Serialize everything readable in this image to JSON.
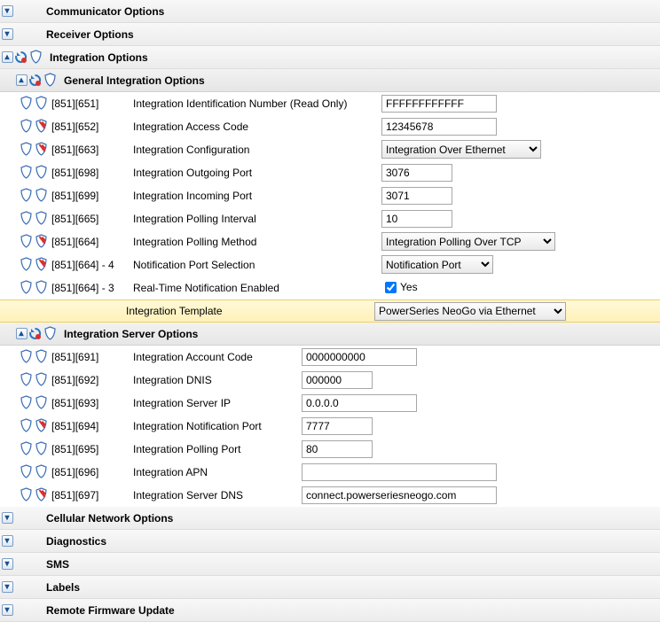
{
  "sections": {
    "communicator": "Communicator Options",
    "receiver": "Receiver Options",
    "integration": "Integration Options",
    "general_integration": "General Integration Options",
    "integration_server": "Integration Server Options",
    "cellular": "Cellular Network Options",
    "diagnostics": "Diagnostics",
    "sms": "SMS",
    "labels": "Labels",
    "remote_fw": "Remote Firmware Update"
  },
  "gen": {
    "items": [
      {
        "code": "[851][651]",
        "label": "Integration Identification Number (Read Only)",
        "type": "text",
        "value": "FFFFFFFFFFFF",
        "shield2": "plain",
        "width": "w130"
      },
      {
        "code": "[851][652]",
        "label": "Integration Access Code",
        "type": "text",
        "value": "12345678",
        "shield2": "red",
        "width": "w130"
      },
      {
        "code": "[851][663]",
        "label": "Integration Configuration",
        "type": "select",
        "value": "Integration Over Ethernet",
        "shield2": "red",
        "width": "180"
      },
      {
        "code": "[851][698]",
        "label": "Integration Outgoing Port",
        "type": "text",
        "value": "3076",
        "shield2": "plain",
        "width": "w80"
      },
      {
        "code": "[851][699]",
        "label": "Integration Incoming Port",
        "type": "text",
        "value": "3071",
        "shield2": "plain",
        "width": "w80"
      },
      {
        "code": "[851][665]",
        "label": "Integration Polling Interval",
        "type": "text",
        "value": "10",
        "shield2": "plain",
        "width": "w80"
      },
      {
        "code": "[851][664]",
        "label": "Integration Polling Method",
        "type": "select",
        "value": "Integration Polling Over TCP",
        "shield2": "red",
        "width": "196"
      },
      {
        "code": "[851][664] - 4",
        "label": "Notification Port Selection",
        "type": "select",
        "value": "Notification Port",
        "shield2": "red",
        "width": "126"
      },
      {
        "code": "[851][664] - 3",
        "label": "Real-Time Notification Enabled",
        "type": "check",
        "value": "Yes",
        "shield2": "plain"
      }
    ]
  },
  "template": {
    "label": "Integration Template",
    "value": "PowerSeries NeoGo via Ethernet"
  },
  "srv": {
    "items": [
      {
        "code": "[851][691]",
        "label": "Integration Account Code",
        "type": "text",
        "value": "0000000000",
        "shield2": "plain",
        "width": "w130"
      },
      {
        "code": "[851][692]",
        "label": "Integration DNIS",
        "type": "text",
        "value": "000000",
        "shield2": "plain",
        "width": "w80"
      },
      {
        "code": "[851][693]",
        "label": "Integration Server IP",
        "type": "text",
        "value": "0.0.0.0",
        "shield2": "plain",
        "width": "w130"
      },
      {
        "code": "[851][694]",
        "label": "Integration Notification Port",
        "type": "text",
        "value": "7777",
        "shield2": "red",
        "width": "w80"
      },
      {
        "code": "[851][695]",
        "label": "Integration Polling Port",
        "type": "text",
        "value": "80",
        "shield2": "plain",
        "width": "w80"
      },
      {
        "code": "[851][696]",
        "label": "Integration APN",
        "type": "text",
        "value": "",
        "shield2": "plain",
        "width": "w220"
      },
      {
        "code": "[851][697]",
        "label": "Integration Server DNS",
        "type": "text",
        "value": "connect.powerseriesneogo.com",
        "shield2": "red",
        "width": "w220"
      }
    ]
  }
}
